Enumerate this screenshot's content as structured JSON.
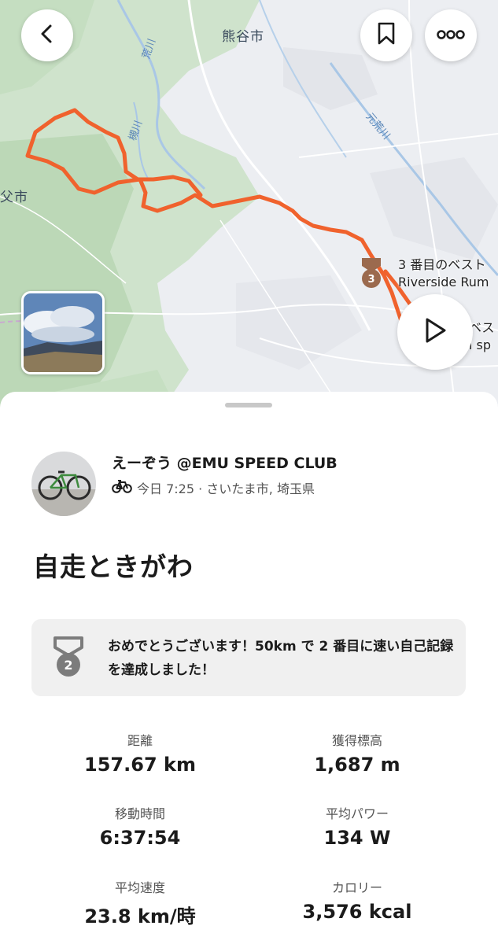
{
  "map": {
    "city_label": "熊谷市",
    "city2_label": "父市",
    "river_labels": [
      "荒川",
      "槻川",
      "元荒川"
    ],
    "segments": [
      {
        "line1": "3 番目のベスト",
        "line2": "Riverside Rum"
      },
      {
        "line1": "ベス",
        "line2": "i sp"
      }
    ],
    "segment_badge_number": "3",
    "route_color": "#f0622d"
  },
  "controls": {
    "back_icon": "chevron-left-icon",
    "bookmark_icon": "bookmark-icon",
    "more_icon": "more-dots-icon",
    "play_icon": "play-icon"
  },
  "activity": {
    "athlete": "えーぞう @EMU SPEED CLUB",
    "sport_icon": "bicycle-icon",
    "time_location": "今日 7:25 · さいたま市, 埼玉県",
    "title": "自走ときがわ"
  },
  "achievement": {
    "rank": "2",
    "text": "おめでとうございます！50km で 2 番目に速い自己記録を達成しました！"
  },
  "stats": [
    {
      "label": "距離",
      "value": "157.67 km"
    },
    {
      "label": "獲得標高",
      "value": "1,687 m"
    },
    {
      "label": "移動時間",
      "value": "6:37:54"
    },
    {
      "label": "平均パワー",
      "value": "134 W"
    },
    {
      "label": "平均速度",
      "value": "23.8 km/時"
    },
    {
      "label": "カロリー",
      "value": "3,576 kcal"
    }
  ]
}
